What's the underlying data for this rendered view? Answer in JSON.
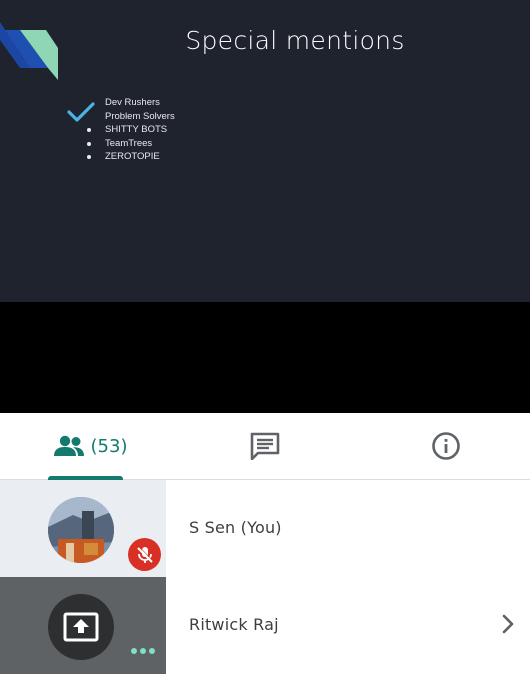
{
  "slide": {
    "title": "Special mentions",
    "mentions": [
      "Dev Rushers",
      "Problem Solvers",
      "SHITTY BOTS",
      "TeamTrees",
      "ZEROTOPIE"
    ]
  },
  "panel": {
    "tabs": {
      "people_count": "(53)",
      "people_icon": "people-icon",
      "chat_icon": "chat-icon",
      "info_icon": "info-icon"
    },
    "participants": [
      {
        "name": "S Sen (You)",
        "status": "mic-off-icon"
      },
      {
        "name": "Ritwick Raj",
        "status": "presenting-icon"
      }
    ]
  },
  "colors": {
    "accent": "#137a6d",
    "mic_off": "#d93025",
    "slide_bg": "#1f232e"
  }
}
